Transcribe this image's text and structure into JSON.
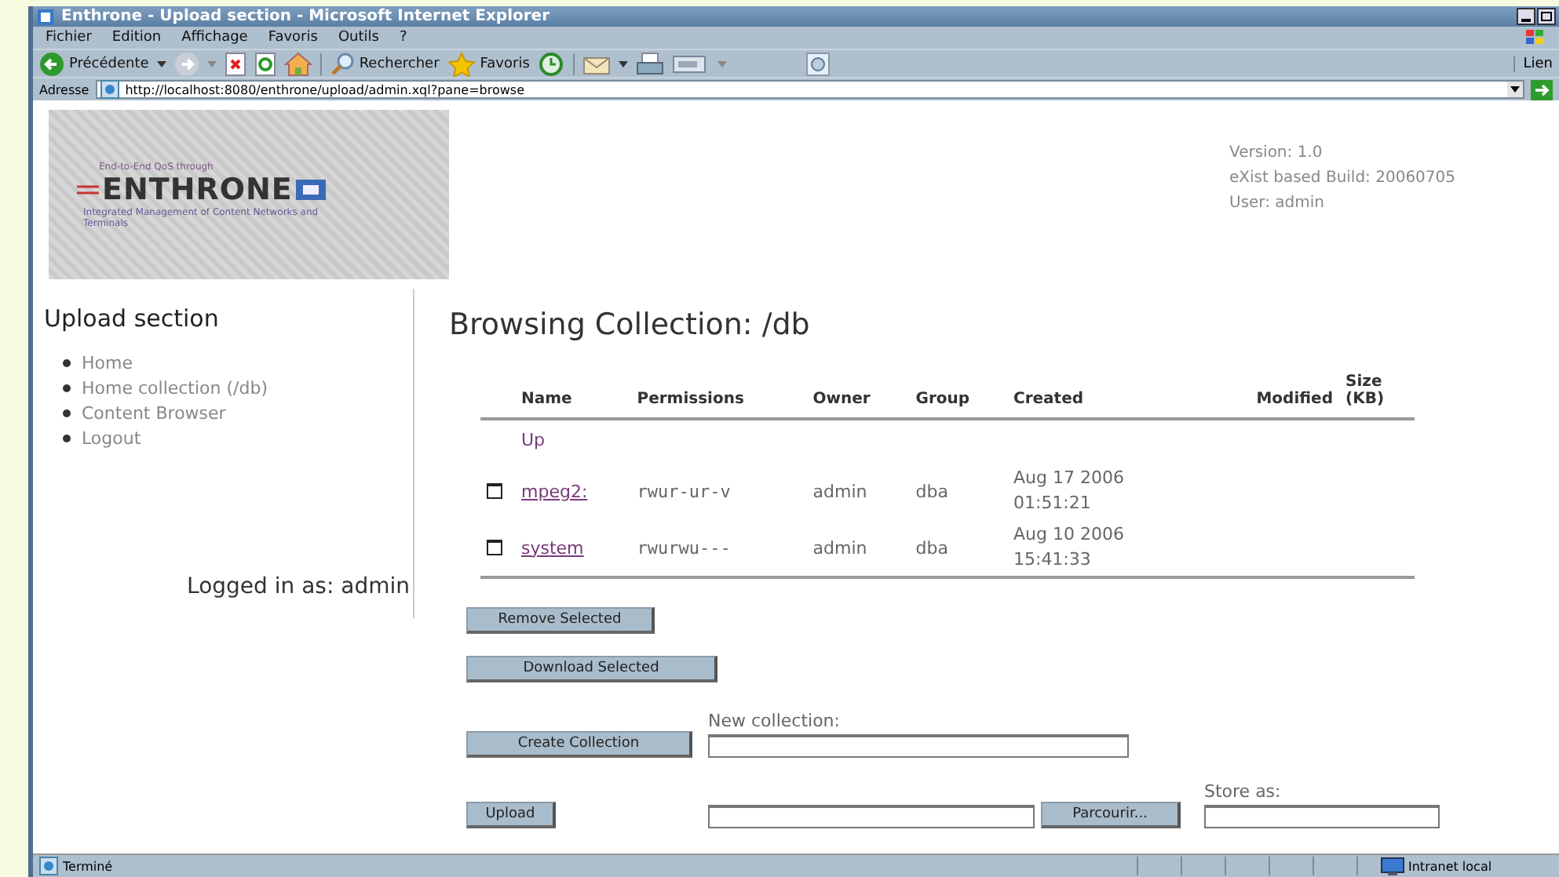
{
  "window": {
    "title": "Enthrone - Upload section - Microsoft Internet Explorer"
  },
  "menu": [
    "Fichier",
    "Edition",
    "Affichage",
    "Favoris",
    "Outils",
    "?"
  ],
  "toolbar": {
    "back_label": "Précédente",
    "search_label": "Rechercher",
    "favorites_label": "Favoris",
    "links_label": "Lien"
  },
  "address": {
    "label": "Adresse",
    "url": "http://localhost:8080/enthrone/upload/admin.xql?pane=browse"
  },
  "header": {
    "logo": {
      "tagline": "End-to-End QoS through",
      "name": "ENTHRONE",
      "subtitle": "Integrated Management of Content Networks and Terminals"
    },
    "info": [
      "Version: 1.0",
      "eXist based Build: 20060705",
      "User: admin"
    ]
  },
  "sidebar": {
    "title": "Upload section",
    "items": [
      "Home",
      "Home collection (/db)",
      "Content Browser",
      "Logout"
    ],
    "logged_in": "Logged in as: admin"
  },
  "main": {
    "heading": "Browsing Collection: /db",
    "table": {
      "columns": [
        "Name",
        "Permissions",
        "Owner",
        "Group",
        "Created",
        "Modified",
        "Size (KB)"
      ],
      "up_link": "Up",
      "rows": [
        {
          "checked": false,
          "name": "mpeg2:",
          "permissions": "rwur-ur-v",
          "owner": "admin",
          "group": "dba",
          "created": "Aug 17 2006 01:51:21"
        },
        {
          "checked": false,
          "name": "system",
          "permissions": "rwurwu---",
          "owner": "admin",
          "group": "dba",
          "created": "Aug 10 2006 15:41:33"
        }
      ]
    },
    "buttons": {
      "remove": "Remove Selected",
      "download": "Download Selected",
      "create": "Create Collection",
      "upload": "Upload",
      "browse": "Parcourir..."
    },
    "new_collection_label": "New collection:",
    "store_as_label": "Store as:"
  },
  "status_bar": {
    "text": "Terminé",
    "zone": "Intranet local"
  }
}
